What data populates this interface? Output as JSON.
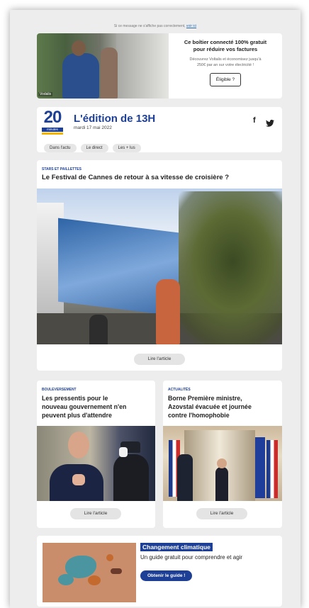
{
  "preheader": {
    "text": "Si ce message ne s'affiche pas correctement,",
    "link": "voir ici"
  },
  "ad": {
    "photo_tag": "Vodalis",
    "headline_line1": "Ce boîtier connecté 100% gratuit",
    "headline_line2": "pour réduire vos factures",
    "body_line1": "Découvrez Voltalis et économisez jusqu'à",
    "body_line2": "250€ par an sur votre électricité !",
    "button": "Éligible ?"
  },
  "header": {
    "logo_number": "20",
    "logo_word": "minutes",
    "title": "L'édition de 13H",
    "date": "mardi 17 mai 2022",
    "social": {
      "facebook": "f",
      "twitter_icon": "twitter-icon"
    },
    "pills": [
      "Dans l'actu",
      "Le direct",
      "Les + lus"
    ]
  },
  "article_main": {
    "kicker": "STARS ET PAILLETTES",
    "title": "Le Festival de Cannes de retour à sa vitesse de croisière ?",
    "button": "Lire l'article"
  },
  "article_left": {
    "kicker": "BOULEVERSEMENT",
    "title_lines": [
      "Les pressentis pour le",
      "nouveau gouvernement n'en",
      "peuvent plus d'attendre"
    ],
    "button": "Lire l'article"
  },
  "article_right": {
    "kicker": "ACTUALITÉS",
    "title_lines": [
      "Borne Première ministre,",
      "Azovstal évacuée et journée",
      "contre l'homophobie"
    ],
    "button": "Lire l'article"
  },
  "promo": {
    "tag": "Changement climatique",
    "text": "Un guide gratuit pour comprendre et agir",
    "button": "Obtenir le guide !"
  }
}
